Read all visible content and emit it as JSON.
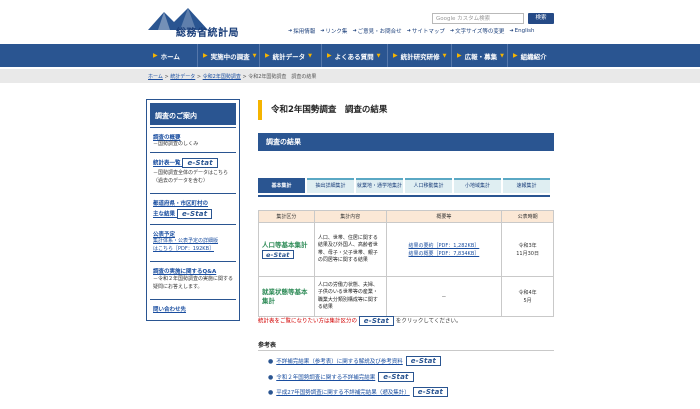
{
  "header": {
    "site_title": "総務省統計局",
    "search_placeholder": "Google カスタム検索",
    "search_button": "検索",
    "util_links": [
      "採用情報",
      "リンク集",
      "ご意見・お問合せ",
      "サイトマップ",
      "文字サイズ等の変更",
      "English"
    ]
  },
  "global_nav": [
    {
      "label": "ホーム"
    },
    {
      "label": "実施中の調査"
    },
    {
      "label": "統計データ"
    },
    {
      "label": "よくある質問"
    },
    {
      "label": "統計研究研修"
    },
    {
      "label": "広報・募集"
    },
    {
      "label": "組織紹介"
    }
  ],
  "breadcrumb": {
    "items": [
      "ホーム",
      "統計データ",
      "令和2年国勢調査"
    ],
    "sep": ">",
    "current": "令和2年国勢調査　調査の結果"
  },
  "sidebar": {
    "heading": "調査のご案内",
    "estat_label": "e-Stat",
    "items": [
      {
        "label": "調査の概要",
        "note": "－国勢調査のしくみ"
      },
      {
        "label": "統計表一覧",
        "note": "－国勢調査全体のデータはこちら（過去のデータを含む）"
      },
      {
        "label": "都道府県・市区町村の",
        "label2": "主な結果"
      },
      {
        "label": "公表予定",
        "note_link1": "集計体系・公表予定の詳細版",
        "note_link2": "はこちら［PDF：192KB］"
      },
      {
        "label": "調査の実施に関するQ&A",
        "note": "－令和２年国勢調査の実施に関する疑問にお答えします。"
      },
      {
        "label": "問い合わせ先"
      }
    ]
  },
  "main": {
    "page_title": "令和2年国勢調査　調査の結果",
    "section_heading": "調査の結果",
    "tabs": [
      "基本集計",
      "抽出詳細集計",
      "就業地・通学地集計",
      "人口移動集計",
      "小地域集計",
      "速報集計"
    ],
    "table": {
      "headers": [
        "集計区分",
        "集計内容",
        "概要等",
        "公表時期"
      ],
      "rows": [
        {
          "name": "人口等基本集計",
          "content": "人口、世帯、住居に関する結果及び外国人、高齢者世帯、母子・父子世帯、親子の同居等に関する結果",
          "summary_links": [
            "結果の要約［PDF：1,282KB］",
            "結果の概要［PDF：7,834KB］"
          ],
          "date": "令和3年\n11月30日"
        },
        {
          "name": "就業状態等基本集計",
          "content": "人口の労働力状態、夫婦、子供のいる世帯等の産業・職業大分類別構成等に関する結果",
          "summary_links": [
            "－"
          ],
          "date": "令和4年\n5月"
        }
      ]
    },
    "notice": {
      "red_text": "統計表をご覧になりたい方は集計区分の",
      "suffix": "をクリックしてください。"
    },
    "references": {
      "heading": "参考表",
      "items": [
        "不詳補完結果（参考表）に関する解説及び参考資料",
        "令和２年国勢調査に関する不詳補完結果",
        "平成27年国勢調査に関する不詳補完結果（遡及集計）"
      ]
    }
  },
  "colors": {
    "nav_blue": "#2a5591",
    "accent_yellow": "#f5b400",
    "notice_red": "#d20000",
    "link_blue": "#1a4ea0",
    "row_green": "#2e8b57"
  }
}
